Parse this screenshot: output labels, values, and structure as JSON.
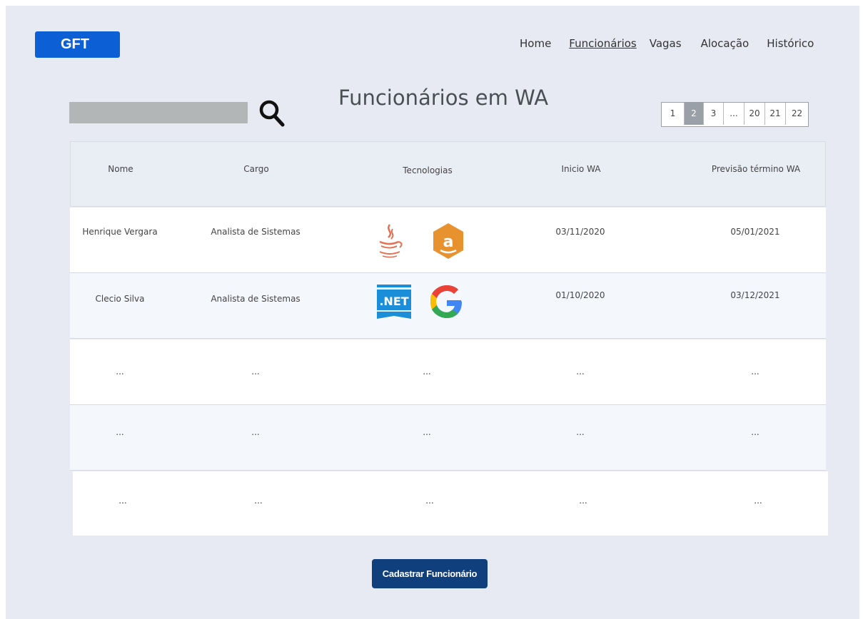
{
  "brand": {
    "logo_text": "GFT",
    "color": "#0d5fd6"
  },
  "nav": {
    "items": [
      {
        "label": "Home",
        "active": false
      },
      {
        "label": "Funcionários",
        "active": true
      },
      {
        "label": "Vagas",
        "active": false
      },
      {
        "label": "Alocação",
        "active": false
      },
      {
        "label": "Histórico",
        "active": false
      }
    ]
  },
  "search": {
    "icon": "search-icon",
    "placeholder": ""
  },
  "page": {
    "title": "Funcionários em WA"
  },
  "pagination": {
    "pages": [
      "1",
      "2",
      "3",
      "...",
      "20",
      "21",
      "22"
    ],
    "current": "2"
  },
  "table": {
    "headers": [
      "Nome",
      "Cargo",
      "Tecnologias",
      "Inicio WA",
      "Previsão término WA"
    ],
    "rows": [
      {
        "nome": "Henrique Vergara",
        "cargo": "Analista de Sistemas",
        "tecnologias": [
          "java-icon",
          "amazon-icon"
        ],
        "inicio": "03/11/2020",
        "termino": "05/01/2021"
      },
      {
        "nome": "Clecio Silva",
        "cargo": "Analista de Sistemas",
        "tecnologias": [
          "dotnet-icon",
          "google-icon"
        ],
        "inicio": "01/10/2020",
        "termino": "03/12/2021"
      },
      {
        "nome": "...",
        "cargo": "...",
        "tecnologias": "...",
        "inicio": "...",
        "termino": "..."
      },
      {
        "nome": "...",
        "cargo": "...",
        "tecnologias": "...",
        "inicio": "...",
        "termino": "..."
      },
      {
        "nome": "...",
        "cargo": "...",
        "tecnologias": "...",
        "inicio": "...",
        "termino": "..."
      }
    ],
    "dotnet_label": ".NET"
  },
  "actions": {
    "cadastrar_label": "Cadastrar Funcionário",
    "color": "#0f3f7d"
  }
}
